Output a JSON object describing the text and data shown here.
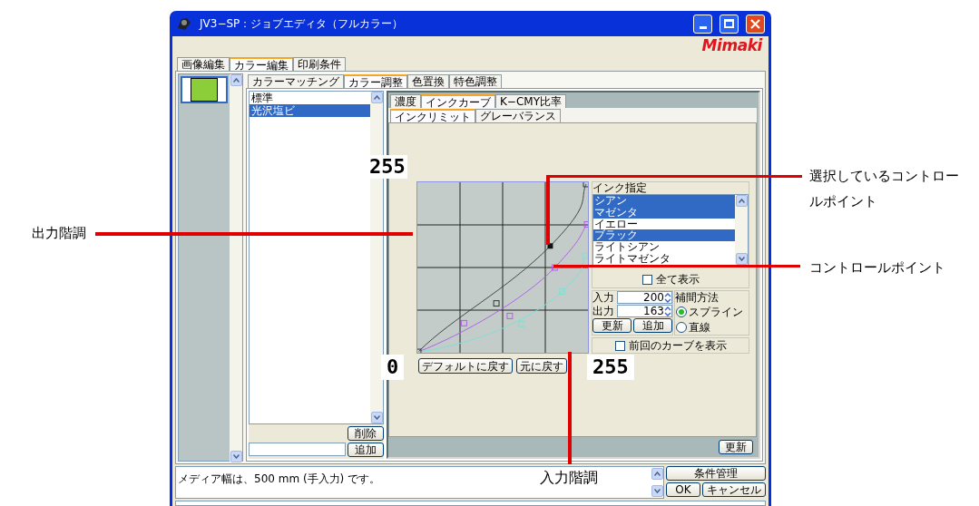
{
  "window": {
    "title": "JV3−SP：ジョブエディタ（フルカラー）",
    "logo": "Mimaki"
  },
  "main_tabs": [
    {
      "label": "画像編集",
      "selected": false
    },
    {
      "label": "カラー編集",
      "selected": true
    },
    {
      "label": "印刷条件",
      "selected": false
    }
  ],
  "color_tabs": [
    {
      "label": "カラーマッチング",
      "selected": false
    },
    {
      "label": "カラー調整",
      "selected": true
    },
    {
      "label": "色置換",
      "selected": false
    },
    {
      "label": "特色調整",
      "selected": false
    }
  ],
  "profiles": {
    "items": [
      {
        "label": "標準",
        "selected": false
      },
      {
        "label": "光沢塩ビ",
        "selected": true
      }
    ],
    "delete_button": "削除",
    "add_button": "追加"
  },
  "curve_tabs": [
    {
      "label": "濃度",
      "selected": false
    },
    {
      "label": "インクカーブ",
      "selected": true
    },
    {
      "label": "K−CMY比率",
      "selected": false
    }
  ],
  "curve_subtabs": [
    {
      "label": "インクリミット",
      "selected": true
    },
    {
      "label": "グレーバランス",
      "selected": false
    }
  ],
  "graph": {
    "reset_default_button": "デフォルトに戻す",
    "undo_button": "元に戻す"
  },
  "ink": {
    "label": "インク指定",
    "items": [
      {
        "label": "シアン",
        "selected": true
      },
      {
        "label": "マゼンタ",
        "selected": true
      },
      {
        "label": "イエロー",
        "selected": false
      },
      {
        "label": "ブラック",
        "selected": true
      },
      {
        "label": "ライトシアン",
        "selected": false
      },
      {
        "label": "ライトマゼンタ",
        "selected": false
      }
    ],
    "show_all": {
      "label": "全て表示",
      "checked": false
    }
  },
  "point": {
    "input_label": "入力",
    "input_value": "200",
    "output_label": "出力",
    "output_value": "163",
    "update_button": "更新",
    "add_button": "追加"
  },
  "interpolation": {
    "label": "補間方法",
    "options": [
      {
        "label": "スプライン",
        "selected": true
      },
      {
        "label": "直線",
        "selected": false
      }
    ]
  },
  "previous_curve": {
    "label": "前回のカーブを表示",
    "checked": false
  },
  "update_button": "更新",
  "status": {
    "message": "メディア幅は、500 mm (手入力) です。",
    "buttons": [
      "条件管理",
      "OK",
      "キャンセル"
    ]
  },
  "axis_labels": {
    "y_max": "255",
    "x_min": "0",
    "x_max": "255"
  },
  "annotations": [
    {
      "kind": "left",
      "text": "出力階調"
    },
    {
      "kind": "right",
      "text": "選択しているコントロールポイント"
    },
    {
      "kind": "right",
      "text": "コントロールポイント"
    },
    {
      "kind": "bottom",
      "text": "入力階調"
    }
  ]
}
